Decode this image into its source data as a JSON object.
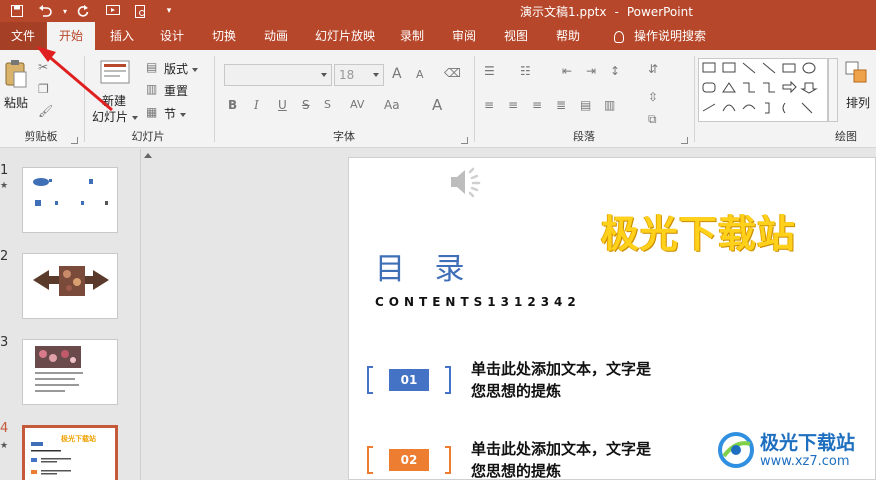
{
  "titlebar": {
    "doc_title": "演示文稿1.pptx",
    "separator": "-",
    "app_name": "PowerPoint",
    "accent": "#b7472a"
  },
  "tabs": [
    {
      "label": "文件"
    },
    {
      "label": "开始"
    },
    {
      "label": "插入"
    },
    {
      "label": "设计"
    },
    {
      "label": "切换"
    },
    {
      "label": "动画"
    },
    {
      "label": "幻灯片放映"
    },
    {
      "label": "录制"
    },
    {
      "label": "审阅"
    },
    {
      "label": "视图"
    },
    {
      "label": "帮助"
    },
    {
      "label": "操作说明搜索"
    }
  ],
  "ribbon": {
    "clipboard": {
      "paste": "粘贴",
      "group": "剪贴板"
    },
    "slides": {
      "new_slide_line1": "新建",
      "new_slide_line2": "幻灯片",
      "layout": "版式",
      "reset": "重置",
      "section": "节",
      "group": "幻灯片"
    },
    "font": {
      "size": "18",
      "bold": "B",
      "italic": "I",
      "underline": "U",
      "strike": "S",
      "spacing": "AV",
      "case": "Aa",
      "color": "A",
      "grow": "A",
      "shrink": "A",
      "group": "字体"
    },
    "paragraph": {
      "group": "段落"
    },
    "drawing": {
      "arrange": "排列",
      "group": "绘图"
    }
  },
  "thumbnails": [
    {
      "num": "1",
      "star": "★"
    },
    {
      "num": "2",
      "star": ""
    },
    {
      "num": "3",
      "star": ""
    },
    {
      "num": "4",
      "star": "★",
      "title": "极光下载站"
    }
  ],
  "slide": {
    "watermark": "极光下载站",
    "title": "目 录",
    "contents": "CONTENTS1312342",
    "items": [
      {
        "num": "01",
        "line1": "单击此处添加文本，文字是",
        "line2": "您思想的提炼",
        "color": "#4472c4"
      },
      {
        "num": "02",
        "line1": "单击此处添加文本，文字是",
        "line2": "您思想的提炼",
        "color": "#ed7d31"
      }
    ]
  },
  "site_logo": {
    "name": "极光下载站",
    "url": "www.xz7.com"
  }
}
